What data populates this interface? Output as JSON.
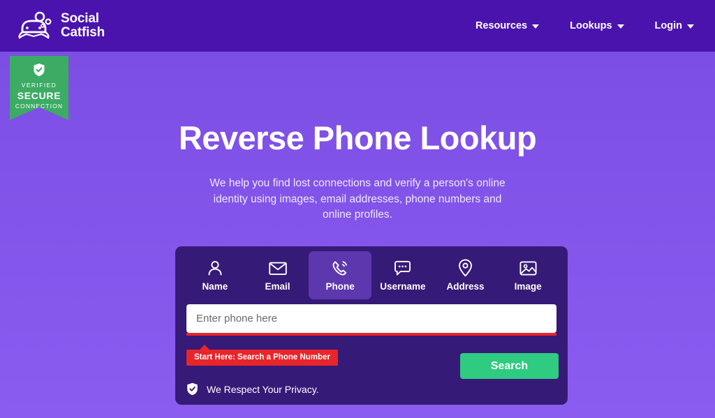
{
  "header": {
    "logo": {
      "icon_name": "catfish-logo-icon",
      "line1": "Social",
      "line2": "Catfish"
    },
    "nav_items": [
      {
        "label": "Resources",
        "has_caret": true
      },
      {
        "label": "Lookups",
        "has_caret": true
      },
      {
        "label": "Login",
        "has_caret": true
      }
    ]
  },
  "badge": {
    "icon_name": "shield-check-icon",
    "line1": "VERIFIED",
    "line2": "SECURE",
    "line3": "CONNECTION"
  },
  "hero": {
    "title": "Reverse Phone Lookup",
    "subtitle": "We help you find lost connections and verify a person's online identity using images, email addresses, phone numbers and online profiles."
  },
  "search_card": {
    "tabs": [
      {
        "label": "Name",
        "icon": "person-icon",
        "active": false
      },
      {
        "label": "Email",
        "icon": "envelope-icon",
        "active": false
      },
      {
        "label": "Phone",
        "icon": "phone-ringing-icon",
        "active": true
      },
      {
        "label": "Username",
        "icon": "chat-bubble-icon",
        "active": false
      },
      {
        "label": "Address",
        "icon": "map-pin-icon",
        "active": false
      },
      {
        "label": "Image",
        "icon": "photo-icon",
        "active": false
      }
    ],
    "input": {
      "placeholder": "Enter phone here",
      "value": ""
    },
    "tooltip": "Start Here: Search a Phone Number",
    "search_button": "Search",
    "privacy": {
      "icon": "shield-check-icon",
      "text": "We Respect Your Privacy."
    }
  },
  "colors": {
    "header_purple": "#4a13ad",
    "background_purple": "#7a4ce2",
    "card_indigo": "#361a77",
    "active_tab": "#5d37ae",
    "badge_green": "#3cab63",
    "button_green": "#2fcb81",
    "alert_red": "#e8252a"
  }
}
